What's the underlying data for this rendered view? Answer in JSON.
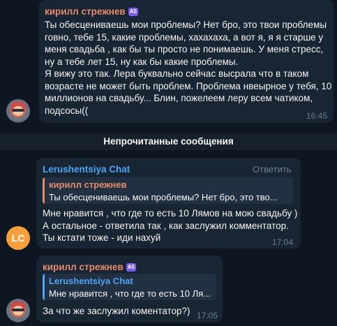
{
  "messages": [
    {
      "author": "кирилл стрежнев",
      "badge": "A5",
      "lines": [
        "Ты обесцениваешь мои проблемы? Нет бро, это твои проблемы",
        "говно, тебе 15, какие проблемы, хахахаха, а вот я, я я старше у",
        "меня свадьба , как бы ты просто не понимаешь. У меня стресс,",
        "ну а тебе лет 15, ну как бы какие проблемы.",
        "Я вижу это так. Лера буквально сейчас высрала что в таком",
        "возрасте не может быть проблем. Проблема нвеырное у тебя, 10",
        "миллионов на свадьбу... Блин, пожелеем леру всем чатиком,",
        "подсосы(("
      ],
      "time": "16:45"
    },
    {
      "author": "Lerushentsiya Chat",
      "avatar_text": "LC",
      "reply_action": "Ответить",
      "reply": {
        "author": "кирилл стрежнев",
        "text": "Ты обесцениваешь мои проблемы? Нет бро, это тво..."
      },
      "lines": [
        "Мне нравится , что где то есть 10 Лямов на мою свадьбу )",
        "А остальное - ответила так , как заслужил комментатор.",
        "Ты кстати тоже - иди нахуй"
      ],
      "time": "17:04"
    },
    {
      "author": "кирилл стрежнев",
      "badge": "A5",
      "reply": {
        "author": "Lerushentsiya Chat",
        "text": "Мне нравится , что где то есть 10 Ля..."
      },
      "lines": [
        "За что же заслужил коментатор?)"
      ],
      "time": "17:05"
    }
  ],
  "divider": "Непрочитанные сообщения",
  "colors": {
    "background": "#0e1621",
    "bubble": "#182533",
    "name_kirill": "#e88b6d",
    "name_lc": "#4ea4f6",
    "avatar_lc": "#f5a03c"
  }
}
